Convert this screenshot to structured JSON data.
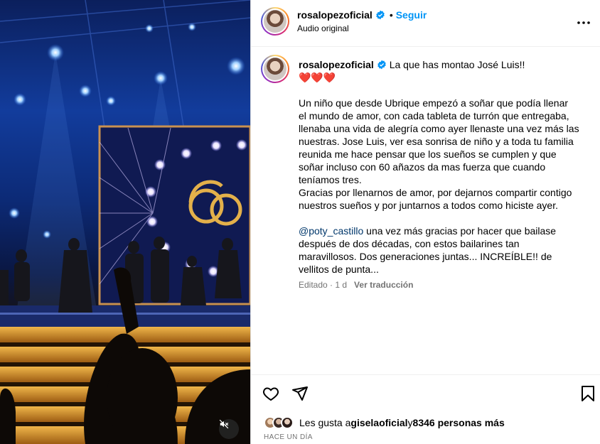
{
  "post": {
    "username": "rosalopezoficial",
    "follow_label": "Seguir",
    "dot": "•",
    "audio": "Audio original",
    "more_icon": "more-horizontal-icon",
    "caption_first": "La que has montao José Luis!!",
    "hearts": "❤️❤️❤️",
    "paragraph1": [
      "Un niño que desde Ubrique empezó a soñar que podía llenar",
      "el mundo de amor, con cada tableta de turrón que entregaba,",
      "llenaba una vida de alegría como ayer llenaste una vez más las",
      "nuestras. Jose Luis, ver esa sonrisa de niño y a toda tu familia",
      "reunida me hace pensar que los sueños se cumplen y que",
      "soñar incluso con 60 añazos da mas fuerza que cuando",
      "teníamos tres.",
      "Gracias por llenarnos de amor, por dejarnos compartir contigo",
      "nuestros sueños y por juntarnos a todos como hiciste ayer."
    ],
    "mention": "@poty_castillo",
    "paragraph2_first_rest": " una vez más gracias por hacer que bailase",
    "paragraph2": [
      "después de dos décadas, con estos bailarines tan",
      "maravillosos. Dos generaciones juntas... INCREÍBLE!! de",
      "vellitos de punta..."
    ],
    "edited": "Editado · 1 d",
    "translate_label": "Ver traducción",
    "likes_prefix": "Les gusta a ",
    "likes_user": "giselaoficial",
    "likes_connector": " y ",
    "likes_count": "8346 personas más",
    "time_ago": "HACE UN DÍA"
  },
  "icons": {
    "like": "heart-icon",
    "share": "send-icon",
    "save": "bookmark-icon",
    "mute": "speaker-muted-icon",
    "verified": "verified-badge-icon"
  },
  "colors": {
    "accent": "#0095f6",
    "verified": "#0095f6",
    "muted_text": "#737373",
    "mention": "#00376b"
  }
}
